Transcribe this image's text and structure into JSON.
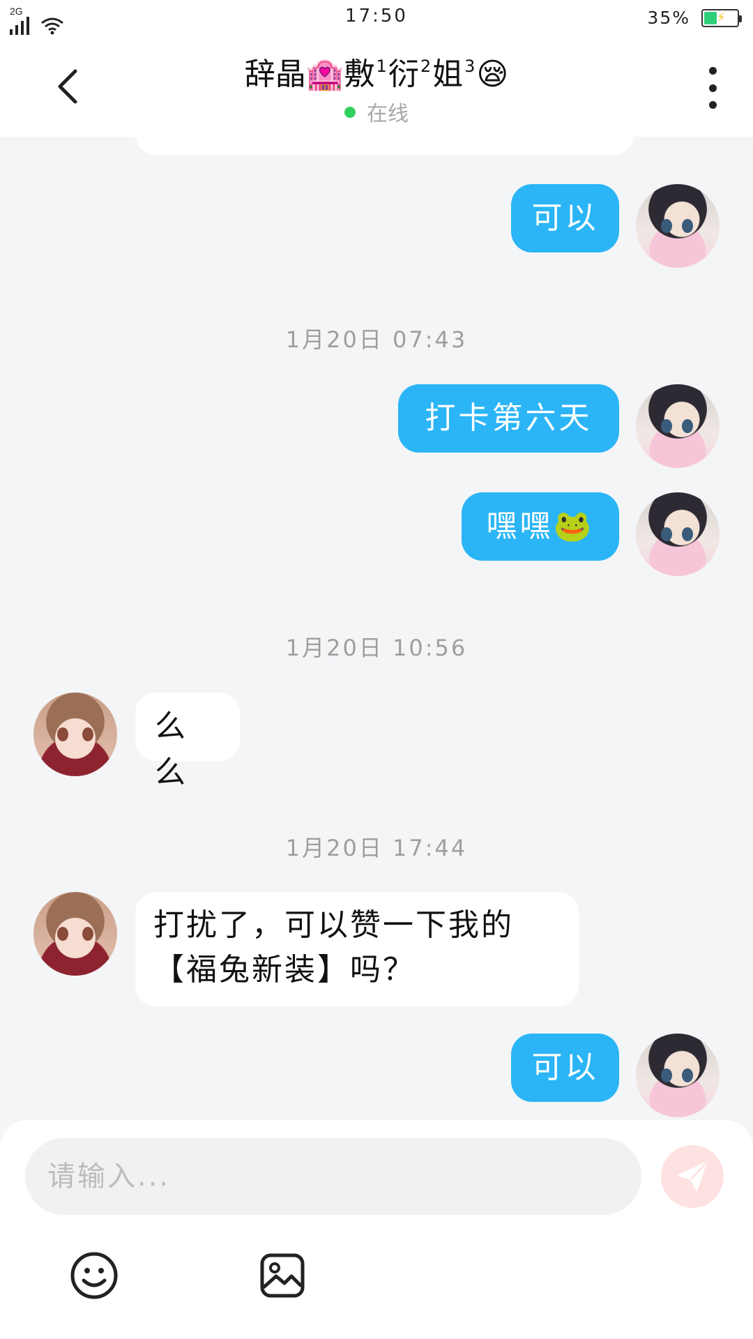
{
  "status_bar": {
    "network": "2G",
    "time": "17:50",
    "battery": "35%",
    "battery_level": 0.35,
    "battery_color": "#2fcf7a"
  },
  "header": {
    "title_parts": [
      "辞晶",
      "🏩",
      "敷",
      "1",
      "衍",
      "2",
      "姐",
      "3",
      "😪"
    ],
    "status": "在线",
    "status_color": "#2fd15b",
    "icons": {
      "back": "back-arrow-icon",
      "more": "more-vertical-icon"
    }
  },
  "messages": [
    {
      "type": "in",
      "text": "…",
      "partial": true
    },
    {
      "type": "out",
      "text": "可以"
    },
    {
      "type": "timestamp",
      "text": "1月20日 07:43"
    },
    {
      "type": "out",
      "text": "打卡第六天"
    },
    {
      "type": "out",
      "text": "嘿嘿🐸"
    },
    {
      "type": "timestamp",
      "text": "1月20日 10:56"
    },
    {
      "type": "in",
      "text": "么么"
    },
    {
      "type": "timestamp",
      "text": "1月20日 17:44"
    },
    {
      "type": "in",
      "text_lines": [
        "打扰了，可以赞一下我的",
        "【福兔新装】吗？"
      ]
    },
    {
      "type": "out",
      "text": "可以"
    }
  ],
  "colors": {
    "outgoing_bubble": "#2bb5f6",
    "incoming_bubble": "#ffffff",
    "chat_background": "#f4f5f7"
  },
  "input": {
    "placeholder": "请输入...",
    "value": "",
    "icons": {
      "send": "send-icon",
      "emoji": "smiley-icon",
      "image": "image-icon"
    }
  }
}
